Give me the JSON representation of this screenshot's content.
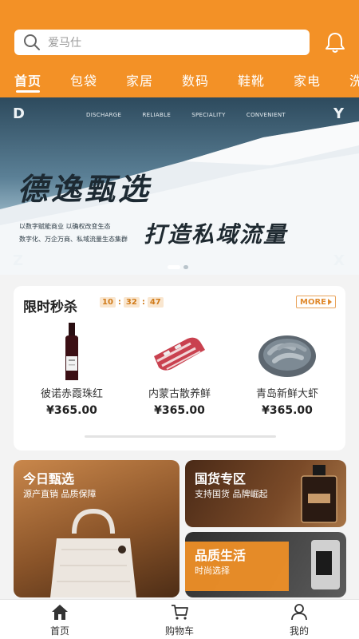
{
  "search": {
    "placeholder": "爱马仕"
  },
  "tabs": [
    {
      "label": "首页",
      "active": true
    },
    {
      "label": "包袋"
    },
    {
      "label": "家居"
    },
    {
      "label": "数码"
    },
    {
      "label": "鞋靴"
    },
    {
      "label": "家电"
    },
    {
      "label": "洗"
    }
  ],
  "banner": {
    "corner_tl": "D",
    "corner_tr": "Y",
    "corner_bl": "Z",
    "corner_br": "X",
    "top_words": [
      "DISCHARGE",
      "RELIABLE",
      "SPECIALITY",
      "CONVENIENT"
    ],
    "title": "德逸甄选",
    "sub_line1": "以数字赋能商业  以确权改变生态",
    "sub_line2": "数字化、万企万商、私域流量生态集群",
    "slogan": "打造私域流量",
    "slides": 2,
    "active_slide": 1
  },
  "flash_sale": {
    "title": "限时秒杀",
    "timer": {
      "h": "10",
      "m": "32",
      "s": "47"
    },
    "more": "MORE",
    "products": [
      {
        "name": "彼诺赤霞珠红",
        "price": "¥365.00",
        "image": "wine-bottle"
      },
      {
        "name": "内蒙古散养鲜",
        "price": "¥365.00",
        "image": "lamb-ribs"
      },
      {
        "name": "青岛新鲜大虾",
        "price": "¥365.00",
        "image": "shrimp-plate"
      }
    ]
  },
  "cards": {
    "left": {
      "title": "今日甄选",
      "sub": "源产直销  品质保障"
    },
    "guohuo": {
      "title": "国货专区",
      "sub": "支持国货  品牌崛起"
    },
    "pinzhi": {
      "title": "品质生活",
      "sub": "时尚选择"
    }
  },
  "bottom_nav": [
    {
      "label": "首页",
      "icon": "home-icon",
      "active": true
    },
    {
      "label": "购物车",
      "icon": "cart-icon"
    },
    {
      "label": "我的",
      "icon": "user-icon"
    }
  ],
  "colors": {
    "brand": "#f39126",
    "text": "#222222"
  }
}
